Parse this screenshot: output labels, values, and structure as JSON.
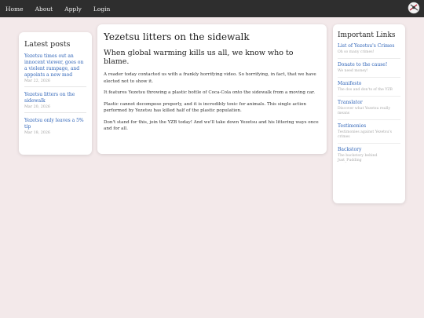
{
  "nav": {
    "items": [
      {
        "label": "Home"
      },
      {
        "label": "About"
      },
      {
        "label": "Apply"
      },
      {
        "label": "Login"
      }
    ],
    "logo_icon": "crossed-swords-emblem-icon"
  },
  "sidebar": {
    "title": "Latest posts",
    "posts": [
      {
        "title": "Yezetsu times out an innocent viewer, goes on a violent rampage, and appoints a new mod",
        "date": "Mar 22, 2026"
      },
      {
        "title": "Yezetsu litters on the sidewalk",
        "date": "Mar 20, 2026"
      },
      {
        "title": "Yezetsu only leaves a 5% tip",
        "date": "Mar 18, 2026"
      }
    ]
  },
  "article": {
    "title": "Yezetsu litters on the sidewalk",
    "subtitle": "When global warming kills us all, we know who to blame.",
    "paragraphs": [
      "A reader today contacted us with a frankly horrifying video. So horrifying, in fact, that we have elected not to show it.",
      "It features Yezetsu throwing a plastic bottle of Coca-Cola onto the sidewalk from a moving car.",
      "Plastic cannot decompose properly, and it is incredibly toxic for animals. This single action performed by Yezetsu has killed half of the plastic population.",
      "Don't stand for this, join the YZB today! And we'll take down Yezetsu and his littering ways once and for all."
    ]
  },
  "links": {
    "title": "Important Links",
    "items": [
      {
        "title": "List of Yezetsu's Crimes",
        "desc": "Oh so many crimes!"
      },
      {
        "title": "Donate to the cause!",
        "desc": "We need money!"
      },
      {
        "title": "Manifesto",
        "desc": "The dos and don'ts of the YZB"
      },
      {
        "title": "Translator",
        "desc": "Discover what Yezetsu really means"
      },
      {
        "title": "Testimonies",
        "desc": "Testimonies against Yezetsu's crimes"
      },
      {
        "title": "Backstory",
        "desc": "The backstory behind Just_Pudding"
      }
    ]
  },
  "colors": {
    "navbar": "#2e2e2e",
    "background": "#f3e9ea",
    "link": "#2f64b8"
  }
}
